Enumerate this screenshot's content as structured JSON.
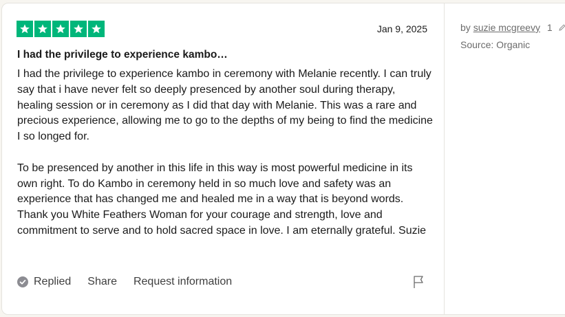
{
  "review": {
    "rating": 5,
    "rating_max": 5,
    "star_color": "#00b67a",
    "date": "Jan 9, 2025",
    "title": "I had the privilege to experience kambo…",
    "paragraphs": [
      "I had the privilege to experience kambo in ceremony with Melanie recently. I can truly say that i have never felt so deeply presenced by another soul during therapy, healing session or in ceremony as I did that day with Melanie. This was a rare and precious experience, allowing me to go to the depths of my being to find the medicine I so longed for.",
      "To be presenced by another in this life in this way is most powerful medicine in its own right. To do Kambo in ceremony held in so much love and safety was an experience that has changed me and healed me in a way that is beyond words. Thank you White Feathers Woman for your courage and strength, love and commitment to serve and to hold sacred space in love. I am eternally grateful. Suzie"
    ]
  },
  "actions": {
    "replied_label": "Replied",
    "share_label": "Share",
    "request_label": "Request information",
    "replied_icon": "check-circle-icon",
    "flag_icon": "flag-icon"
  },
  "sidebar": {
    "by_prefix": "by",
    "username": "suzie mcgreevy",
    "review_count": "1",
    "edit_icon": "pencil-icon",
    "source": "Source: Organic"
  }
}
